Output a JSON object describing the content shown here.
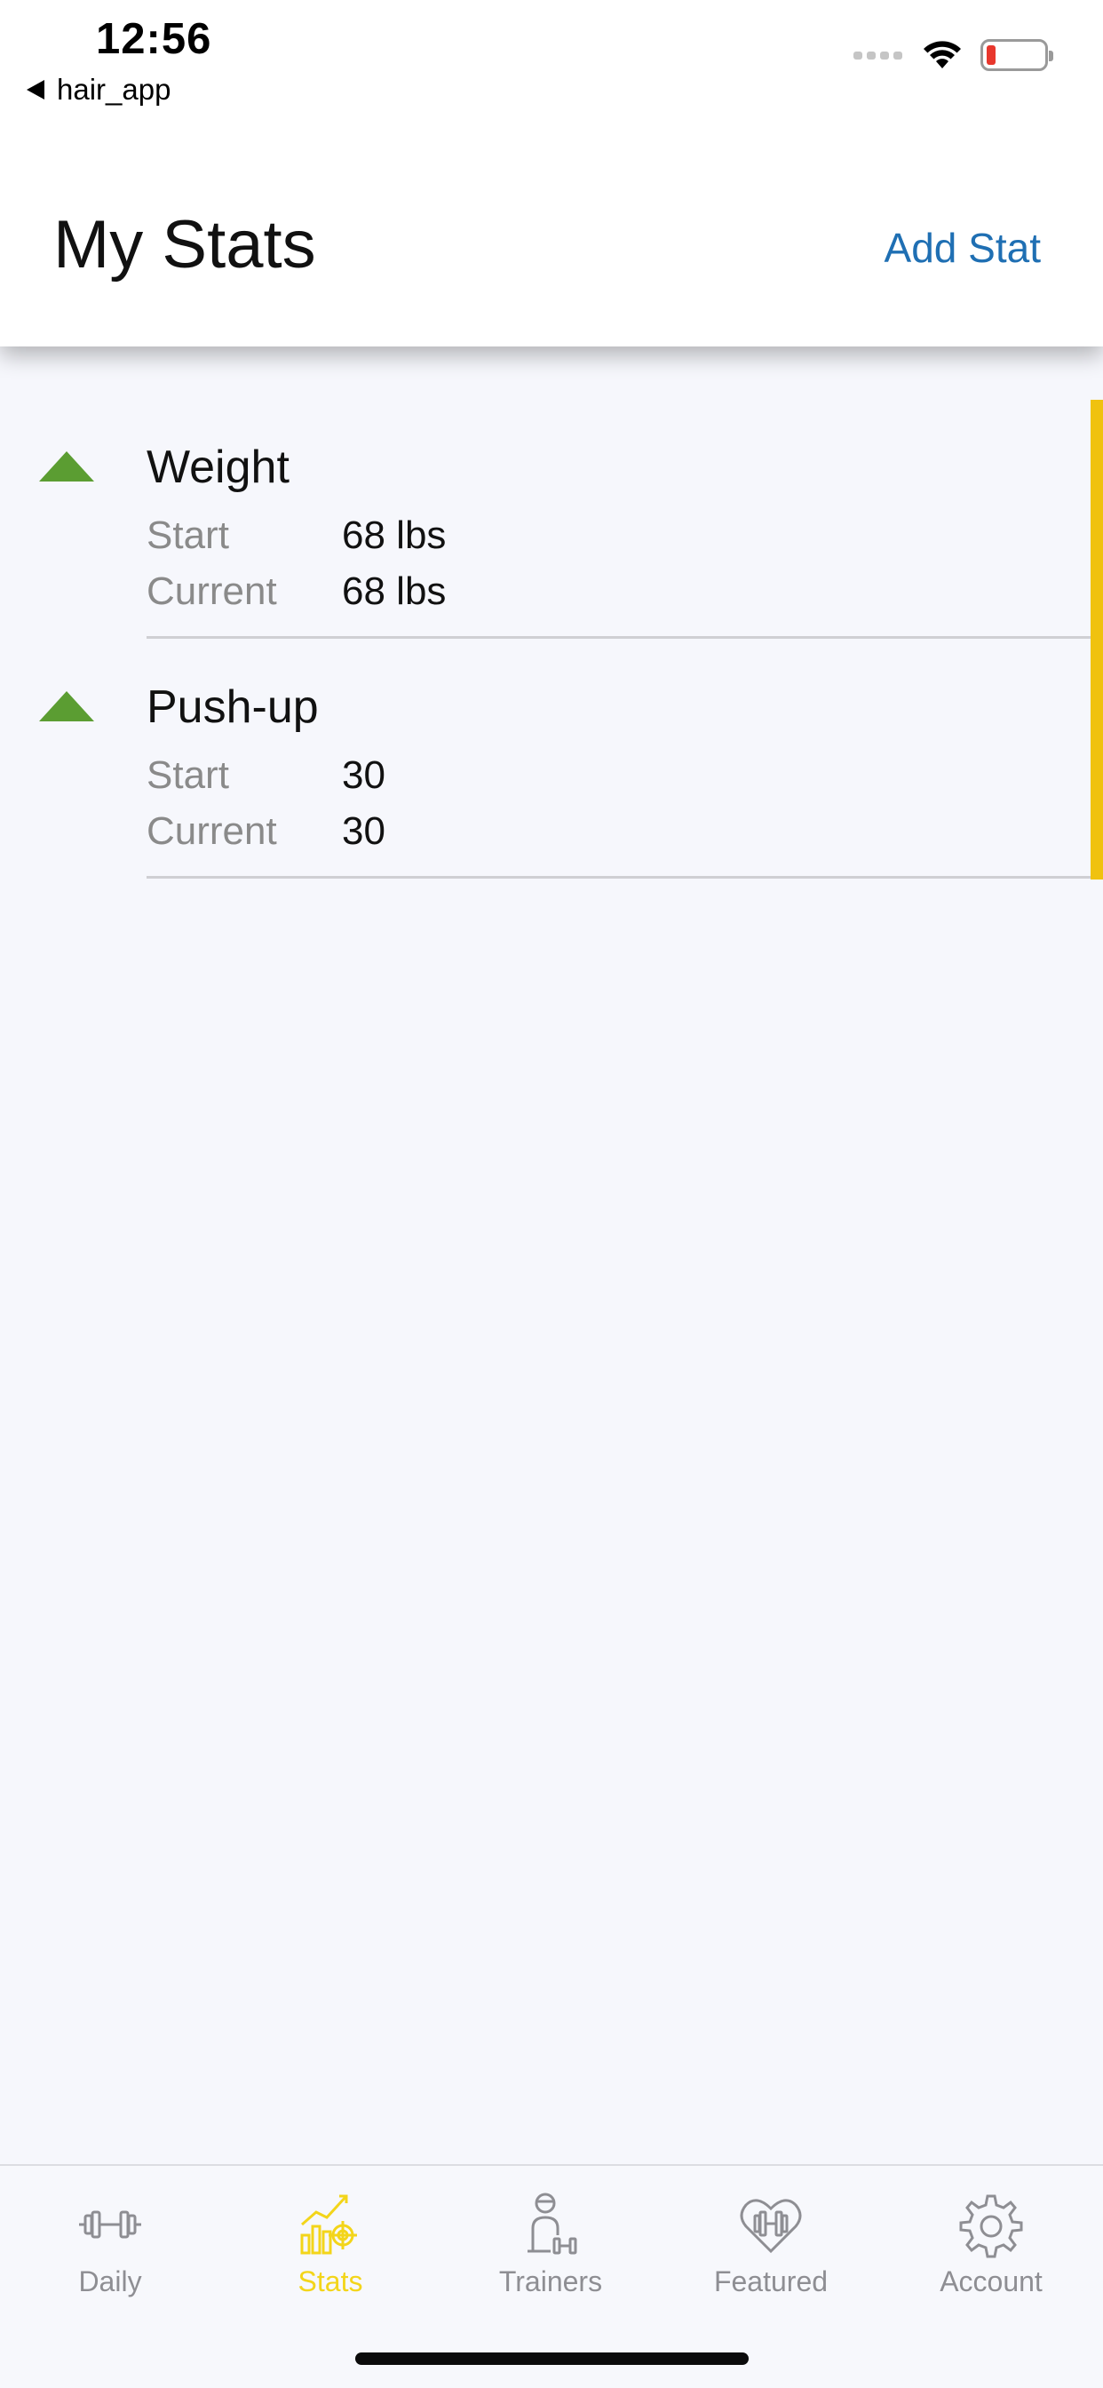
{
  "status_bar": {
    "time": "12:56",
    "back_app": "hair_app",
    "battery_color": "#e8372d"
  },
  "header": {
    "title": "My Stats",
    "add_label": "Add Stat"
  },
  "stats": [
    {
      "name": "Weight",
      "start_label": "Start",
      "start_value": "68 lbs",
      "current_label": "Current",
      "current_value": "68 lbs",
      "trend": "up"
    },
    {
      "name": "Push-up",
      "start_label": "Start",
      "start_value": "30",
      "current_label": "Current",
      "current_value": "30",
      "trend": "up"
    }
  ],
  "tabs": [
    {
      "label": "Daily",
      "icon": "dumbbell-icon",
      "active": false
    },
    {
      "label": "Stats",
      "icon": "stats-chart-icon",
      "active": true
    },
    {
      "label": "Trainers",
      "icon": "trainer-icon",
      "active": false
    },
    {
      "label": "Featured",
      "icon": "heart-dumbbell-icon",
      "active": false
    },
    {
      "label": "Account",
      "icon": "gear-icon",
      "active": false
    }
  ],
  "colors": {
    "accent": "#f3d51a",
    "link": "#1f6fb3",
    "trend_up": "#5b9d32",
    "scroll_indicator": "#f0c20f",
    "inactive_tab": "#8e8e93"
  }
}
